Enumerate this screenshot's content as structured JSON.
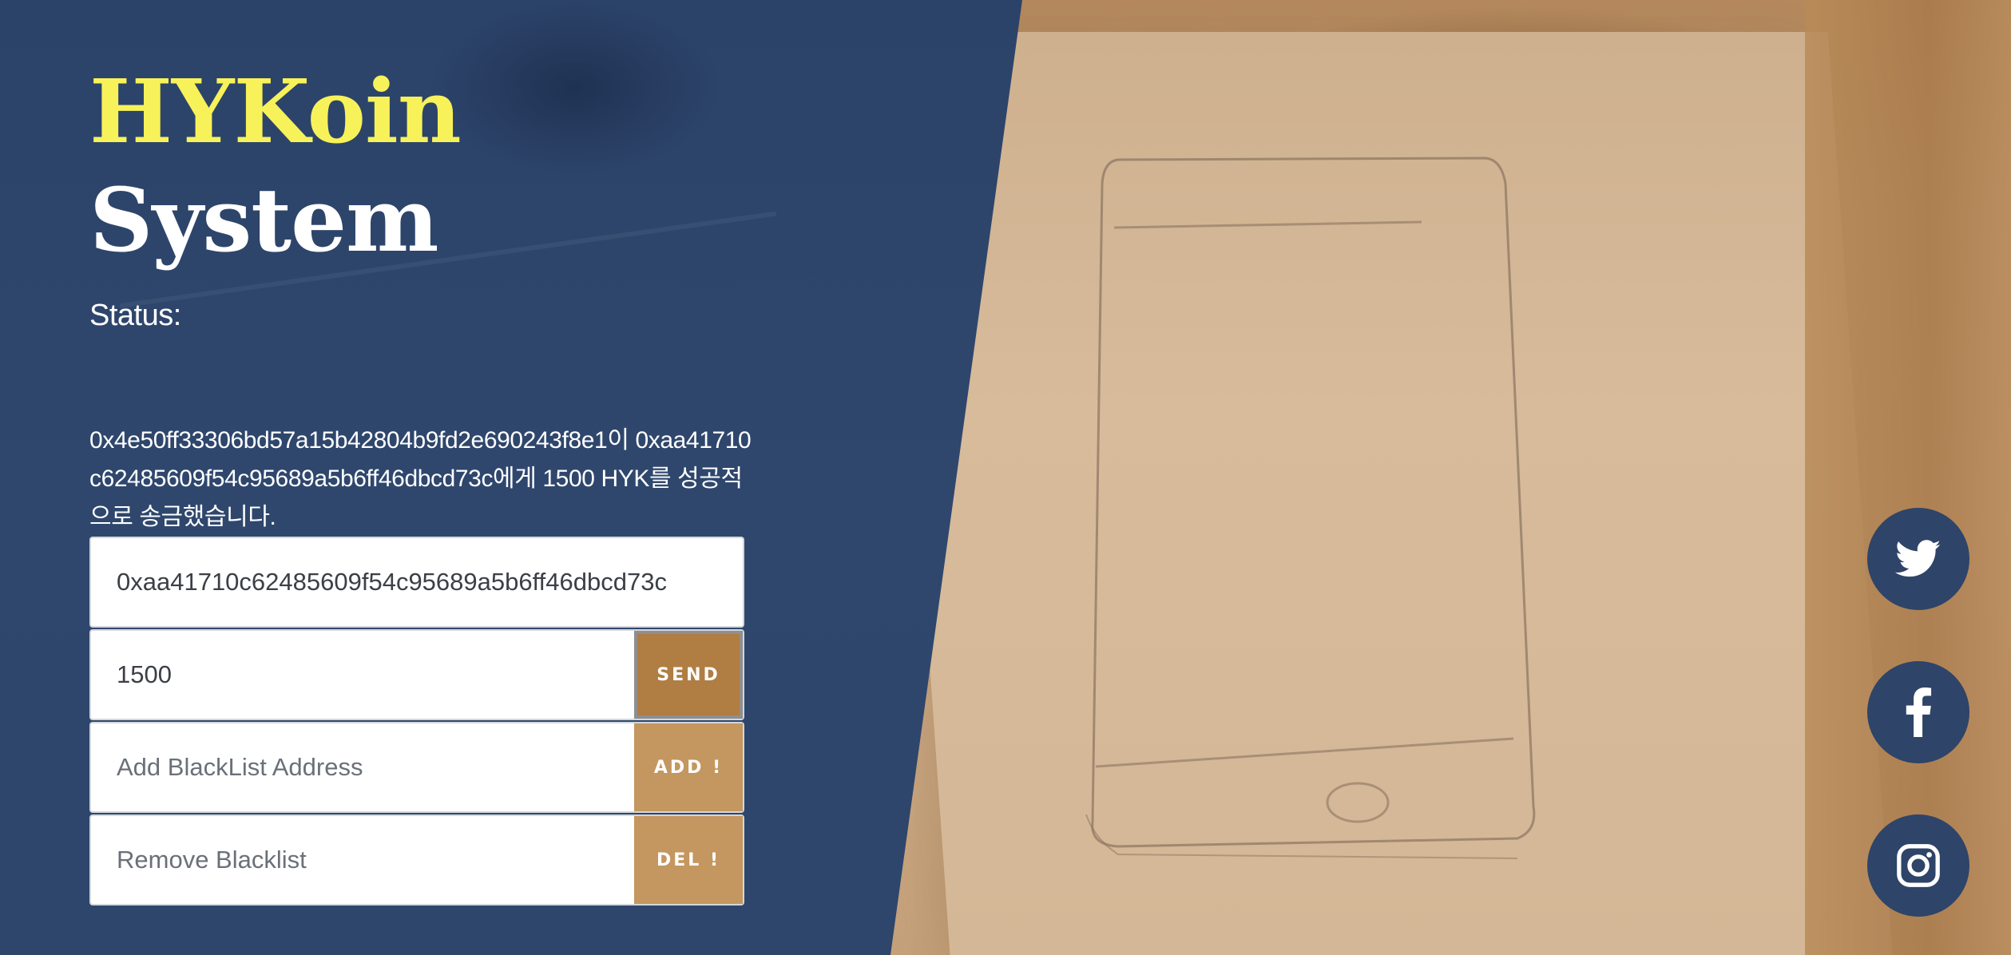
{
  "hero": {
    "title_line1": "HYKoin",
    "title_line2": "System",
    "status_label": "Status:",
    "status_message": "0x4e50ff33306bd57a15b42804b9fd2e690243f8e1이 0xaa41710c62485609f54c95689a5b6ff46dbcd73c에게 1500 HYK를 성공적으로 송금했습니다."
  },
  "form": {
    "address_value": "0xaa41710c62485609f54c95689a5b6ff46dbcd73c",
    "amount_value": "1500",
    "send_label": "SEND",
    "blacklist_add_placeholder": "Add BlackList Address",
    "add_label": "ADD !",
    "blacklist_remove_placeholder": "Remove Blacklist",
    "del_label": "DEL !"
  },
  "social": {
    "icons": [
      "twitter-icon",
      "facebook-icon",
      "instagram-icon"
    ],
    "circle_color": "#2e4469"
  },
  "colors": {
    "panel": "#2e466c",
    "title_accent": "#f7f259",
    "send_button": "#b07d43",
    "action_button": "#c49760"
  }
}
